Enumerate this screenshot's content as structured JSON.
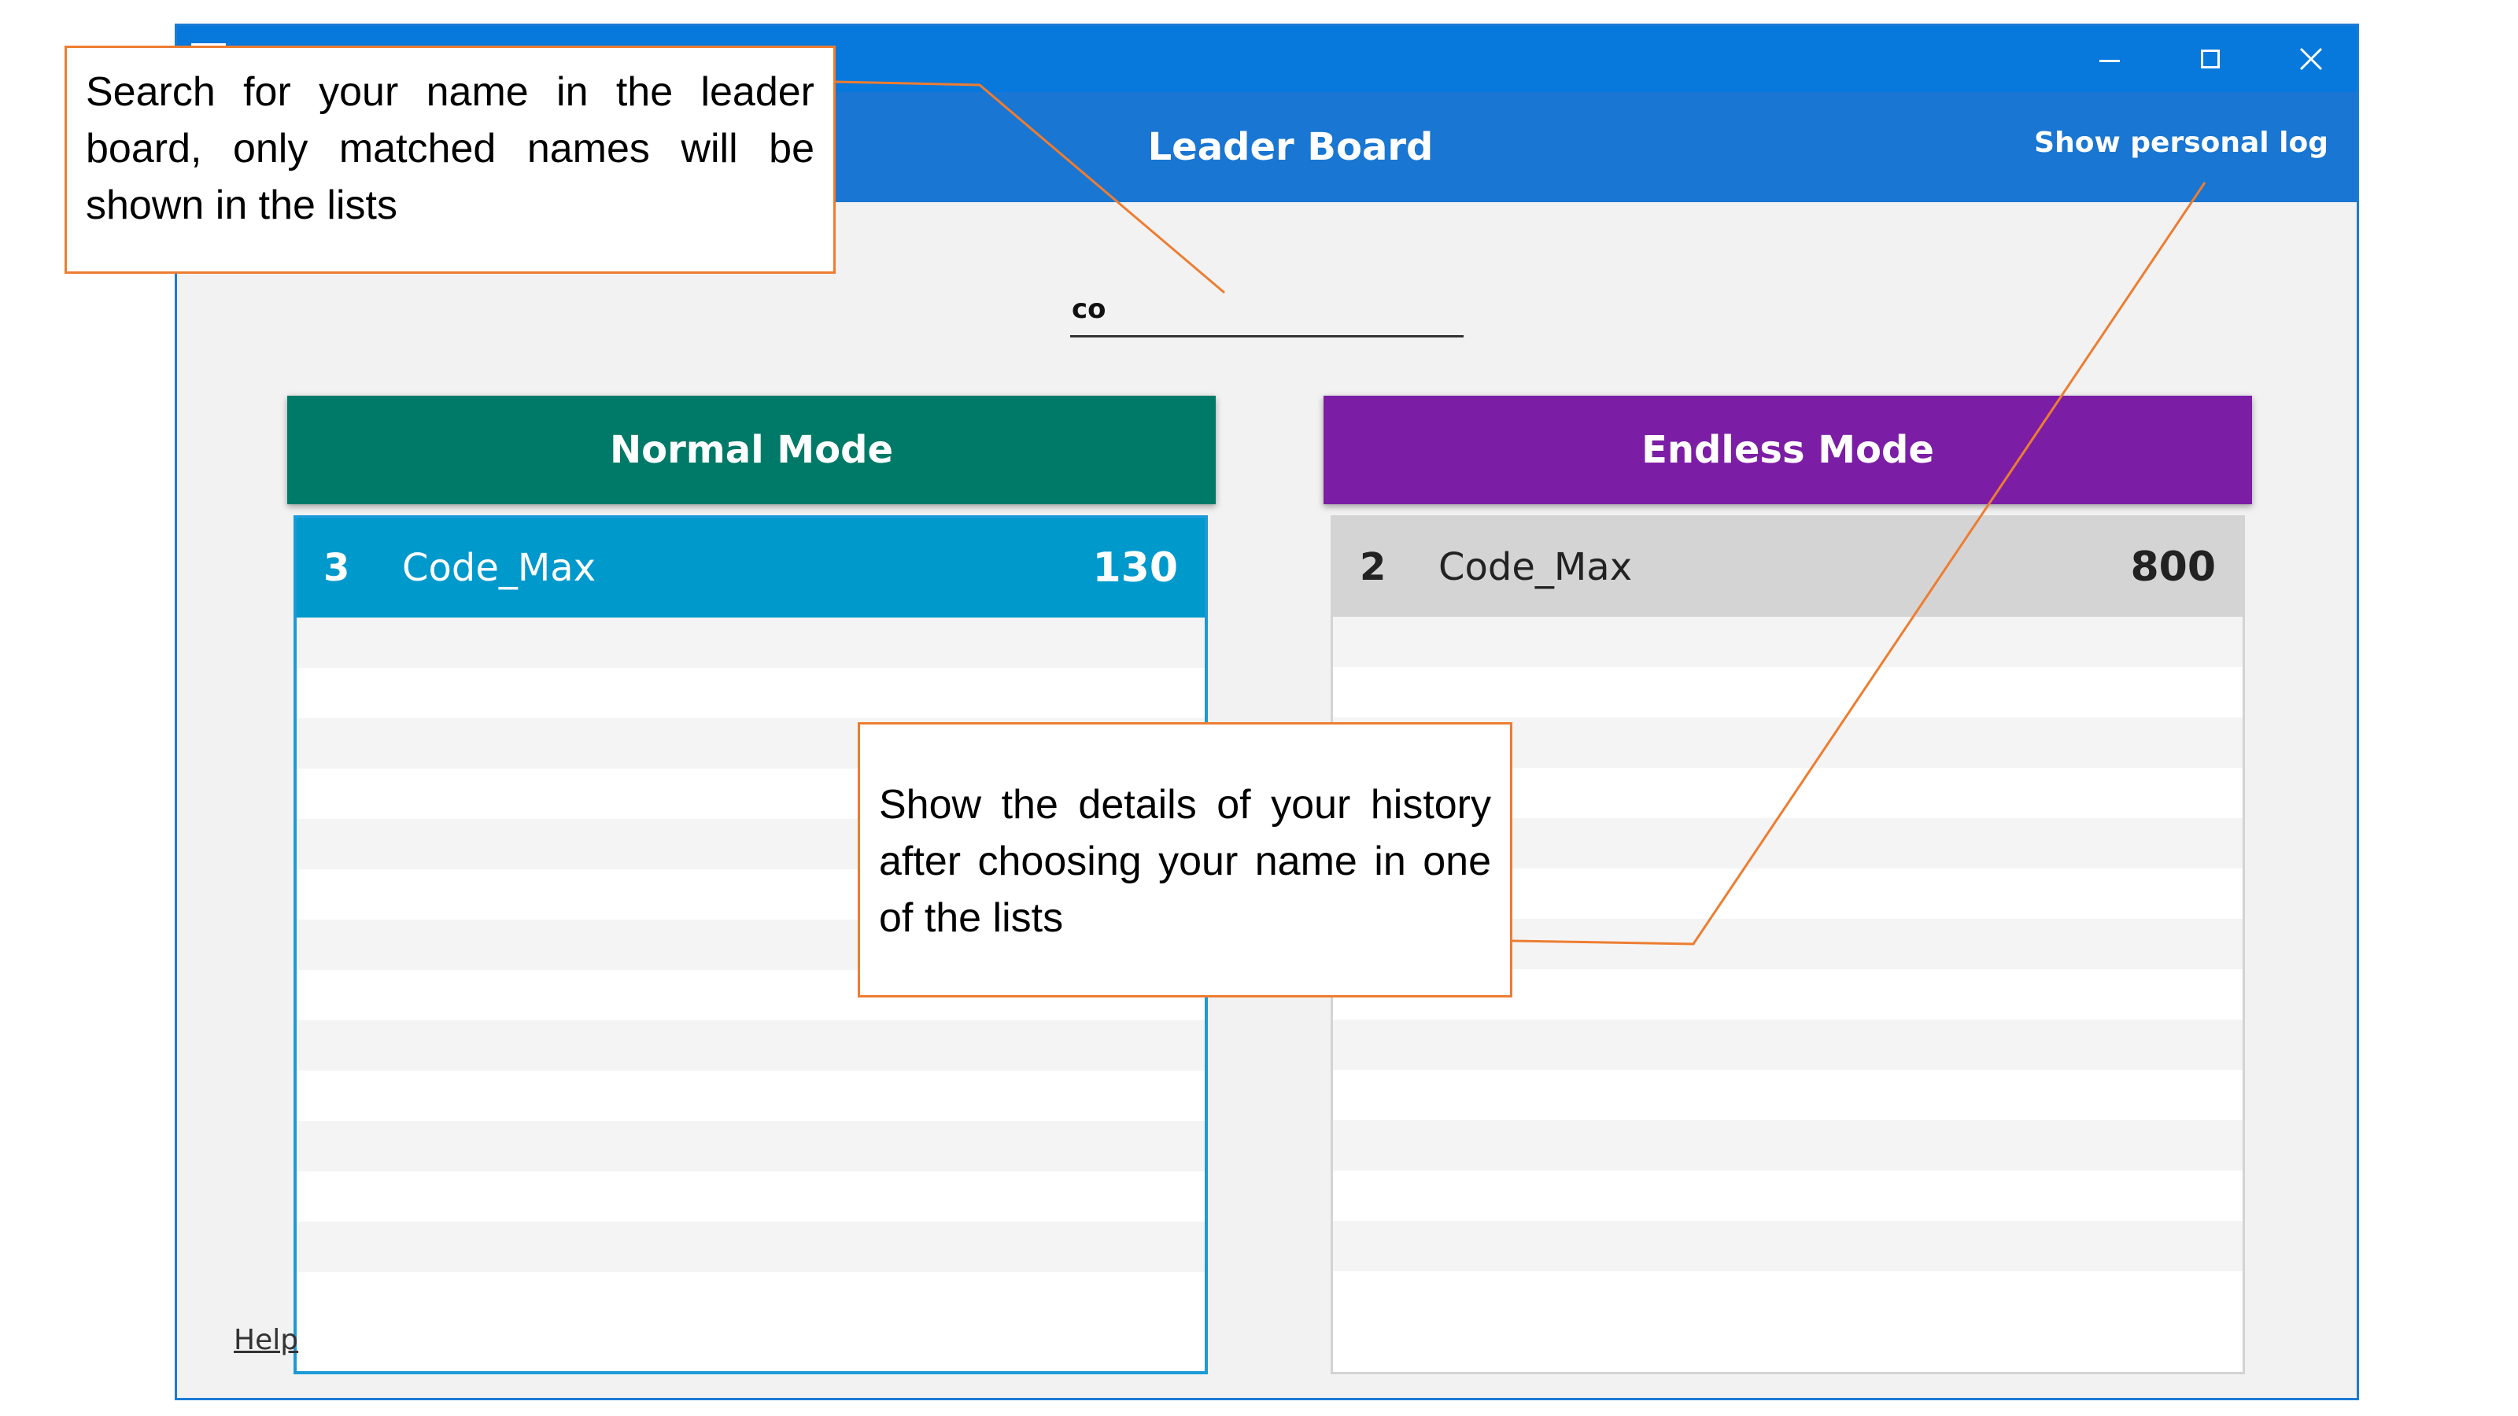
{
  "window": {
    "icon": "app-icon",
    "controls": [
      "minimize-icon",
      "maximize-icon",
      "close-icon"
    ],
    "accent": "#0778dc"
  },
  "appbar": {
    "title": "Leader Board",
    "action_label": "Show personal log",
    "color": "#1976d2"
  },
  "search": {
    "value": "co"
  },
  "normal_mode": {
    "header": "Normal Mode",
    "color": "#007a68",
    "entries": [
      {
        "rank": "3",
        "name": "Code_Max",
        "score": "130",
        "selected": true
      }
    ]
  },
  "endless_mode": {
    "header": "Endless Mode",
    "color": "#7c1ea5",
    "entries": [
      {
        "rank": "2",
        "name": "Code_Max",
        "score": "800",
        "selected": false
      }
    ]
  },
  "footer": {
    "help_label": "Help"
  },
  "annotations": {
    "search_note": "Search for your name in the leader board, only matched names will be shown in the lists",
    "log_note": "Show the details of your history after choosing your name in one of the lists",
    "border_color": "#ed7d31"
  }
}
